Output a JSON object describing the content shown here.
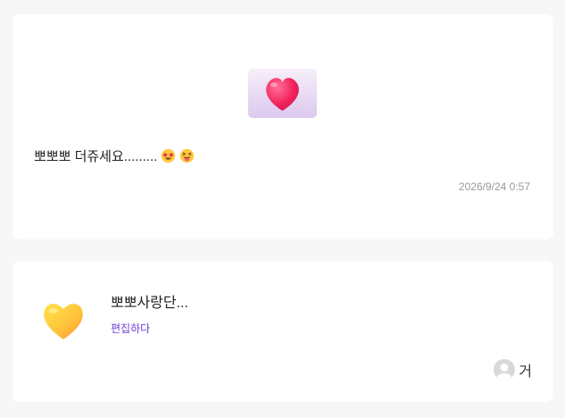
{
  "post": {
    "message": "뽀뽀뽀 더쥬세요.........",
    "emojis": [
      "star-struck-emoji",
      "squinting-tongue-emoji"
    ],
    "timestamp": "2026/9/24 0:57",
    "image_icon": "heart-envelope-icon"
  },
  "group": {
    "title": "뽀뽀사랑단...",
    "edit_label": "편집하다",
    "icon": "yellow-heart-icon",
    "user_name": "거"
  }
}
